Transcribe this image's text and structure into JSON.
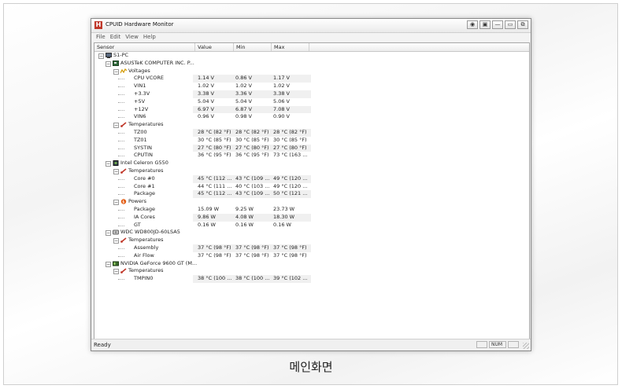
{
  "caption": "메인화면",
  "window": {
    "title": "CPUID Hardware Monitor",
    "app_icon_text": "H",
    "buttons": [
      "◉",
      "▣",
      "—",
      "▭",
      "⧉"
    ]
  },
  "menu": [
    "File",
    "Edit",
    "View",
    "Help"
  ],
  "columns": {
    "sensor": "Sensor",
    "value": "Value",
    "min": "Min",
    "max": "Max"
  },
  "tree": [
    {
      "level": 0,
      "label": "S1-PC",
      "icon": "computer-icon",
      "toggle": "−"
    },
    {
      "level": 1,
      "label": "ASUSTeK COMPUTER INC. P...",
      "icon": "motherboard-icon",
      "toggle": "−"
    },
    {
      "level": 2,
      "label": "Voltages",
      "icon": "voltage-icon",
      "toggle": "−"
    },
    {
      "level": 3,
      "label": "CPU VCORE",
      "value": "1.14 V",
      "min": "0.86 V",
      "max": "1.17 V"
    },
    {
      "level": 3,
      "label": "VIN1",
      "value": "1.02 V",
      "min": "1.02 V",
      "max": "1.02 V"
    },
    {
      "level": 3,
      "label": "+3.3V",
      "value": "3.38 V",
      "min": "3.36 V",
      "max": "3.38 V"
    },
    {
      "level": 3,
      "label": "+5V",
      "value": "5.04 V",
      "min": "5.04 V",
      "max": "5.06 V"
    },
    {
      "level": 3,
      "label": "+12V",
      "value": "6.97 V",
      "min": "6.87 V",
      "max": "7.08 V"
    },
    {
      "level": 3,
      "label": "VIN6",
      "value": "0.96 V",
      "min": "0.98 V",
      "max": "0.90 V"
    },
    {
      "level": 2,
      "label": "Temperatures",
      "icon": "temperature-icon",
      "toggle": "−"
    },
    {
      "level": 3,
      "label": "TZ00",
      "value": "28 °C  (82 °F)",
      "min": "28 °C  (82 °F)",
      "max": "28 °C  (82 °F)"
    },
    {
      "level": 3,
      "label": "TZ01",
      "value": "30 °C  (85 °F)",
      "min": "30 °C  (85 °F)",
      "max": "30 °C  (85 °F)"
    },
    {
      "level": 3,
      "label": "SYSTIN",
      "value": "27 °C  (80 °F)",
      "min": "27 °C  (80 °F)",
      "max": "27 °C  (80 °F)"
    },
    {
      "level": 3,
      "label": "CPUTIN",
      "value": "36 °C  (95 °F)",
      "min": "36 °C  (95 °F)",
      "max": "73 °C  (163 ..."
    },
    {
      "level": 1,
      "label": "Intel Celeron G550",
      "icon": "cpu-icon",
      "toggle": "−"
    },
    {
      "level": 2,
      "label": "Temperatures",
      "icon": "temperature-icon",
      "toggle": "−"
    },
    {
      "level": 3,
      "label": "Core #0",
      "value": "45 °C  (112 ...",
      "min": "43 °C  (109 ...",
      "max": "49 °C  (120 ..."
    },
    {
      "level": 3,
      "label": "Core #1",
      "value": "44 °C  (111 ...",
      "min": "40 °C  (103 ...",
      "max": "49 °C  (120 ..."
    },
    {
      "level": 3,
      "label": "Package",
      "value": "45 °C  (112 ...",
      "min": "43 °C  (109 ...",
      "max": "50 °C  (121 ..."
    },
    {
      "level": 2,
      "label": "Powers",
      "icon": "power-icon",
      "toggle": "−"
    },
    {
      "level": 3,
      "label": "Package",
      "value": "15.09 W",
      "min": "9.25 W",
      "max": "23.73 W"
    },
    {
      "level": 3,
      "label": "IA Cores",
      "value": "9.86 W",
      "min": "4.08 W",
      "max": "18.30 W"
    },
    {
      "level": 3,
      "label": "GT",
      "value": "0.16 W",
      "min": "0.16 W",
      "max": "0.16 W"
    },
    {
      "level": 1,
      "label": "WDC WD800JD-60LSA5",
      "icon": "harddisk-icon",
      "toggle": "−"
    },
    {
      "level": 2,
      "label": "Temperatures",
      "icon": "temperature-icon",
      "toggle": "−"
    },
    {
      "level": 3,
      "label": "Assembly",
      "value": "37 °C  (98 °F)",
      "min": "37 °C  (98 °F)",
      "max": "37 °C  (98 °F)"
    },
    {
      "level": 3,
      "label": "Air Flow",
      "value": "37 °C  (98 °F)",
      "min": "37 °C  (98 °F)",
      "max": "37 °C  (98 °F)"
    },
    {
      "level": 1,
      "label": "NVIDIA GeForce 9600 GT (M...",
      "icon": "gpu-icon",
      "toggle": "−"
    },
    {
      "level": 2,
      "label": "Temperatures",
      "icon": "temperature-icon",
      "toggle": "−"
    },
    {
      "level": 3,
      "label": "TMPIN0",
      "value": "38 °C  (100 ...",
      "min": "38 °C  (100 ...",
      "max": "39 °C  (102 ..."
    }
  ],
  "status": {
    "text": "Ready",
    "num": "NUM"
  }
}
